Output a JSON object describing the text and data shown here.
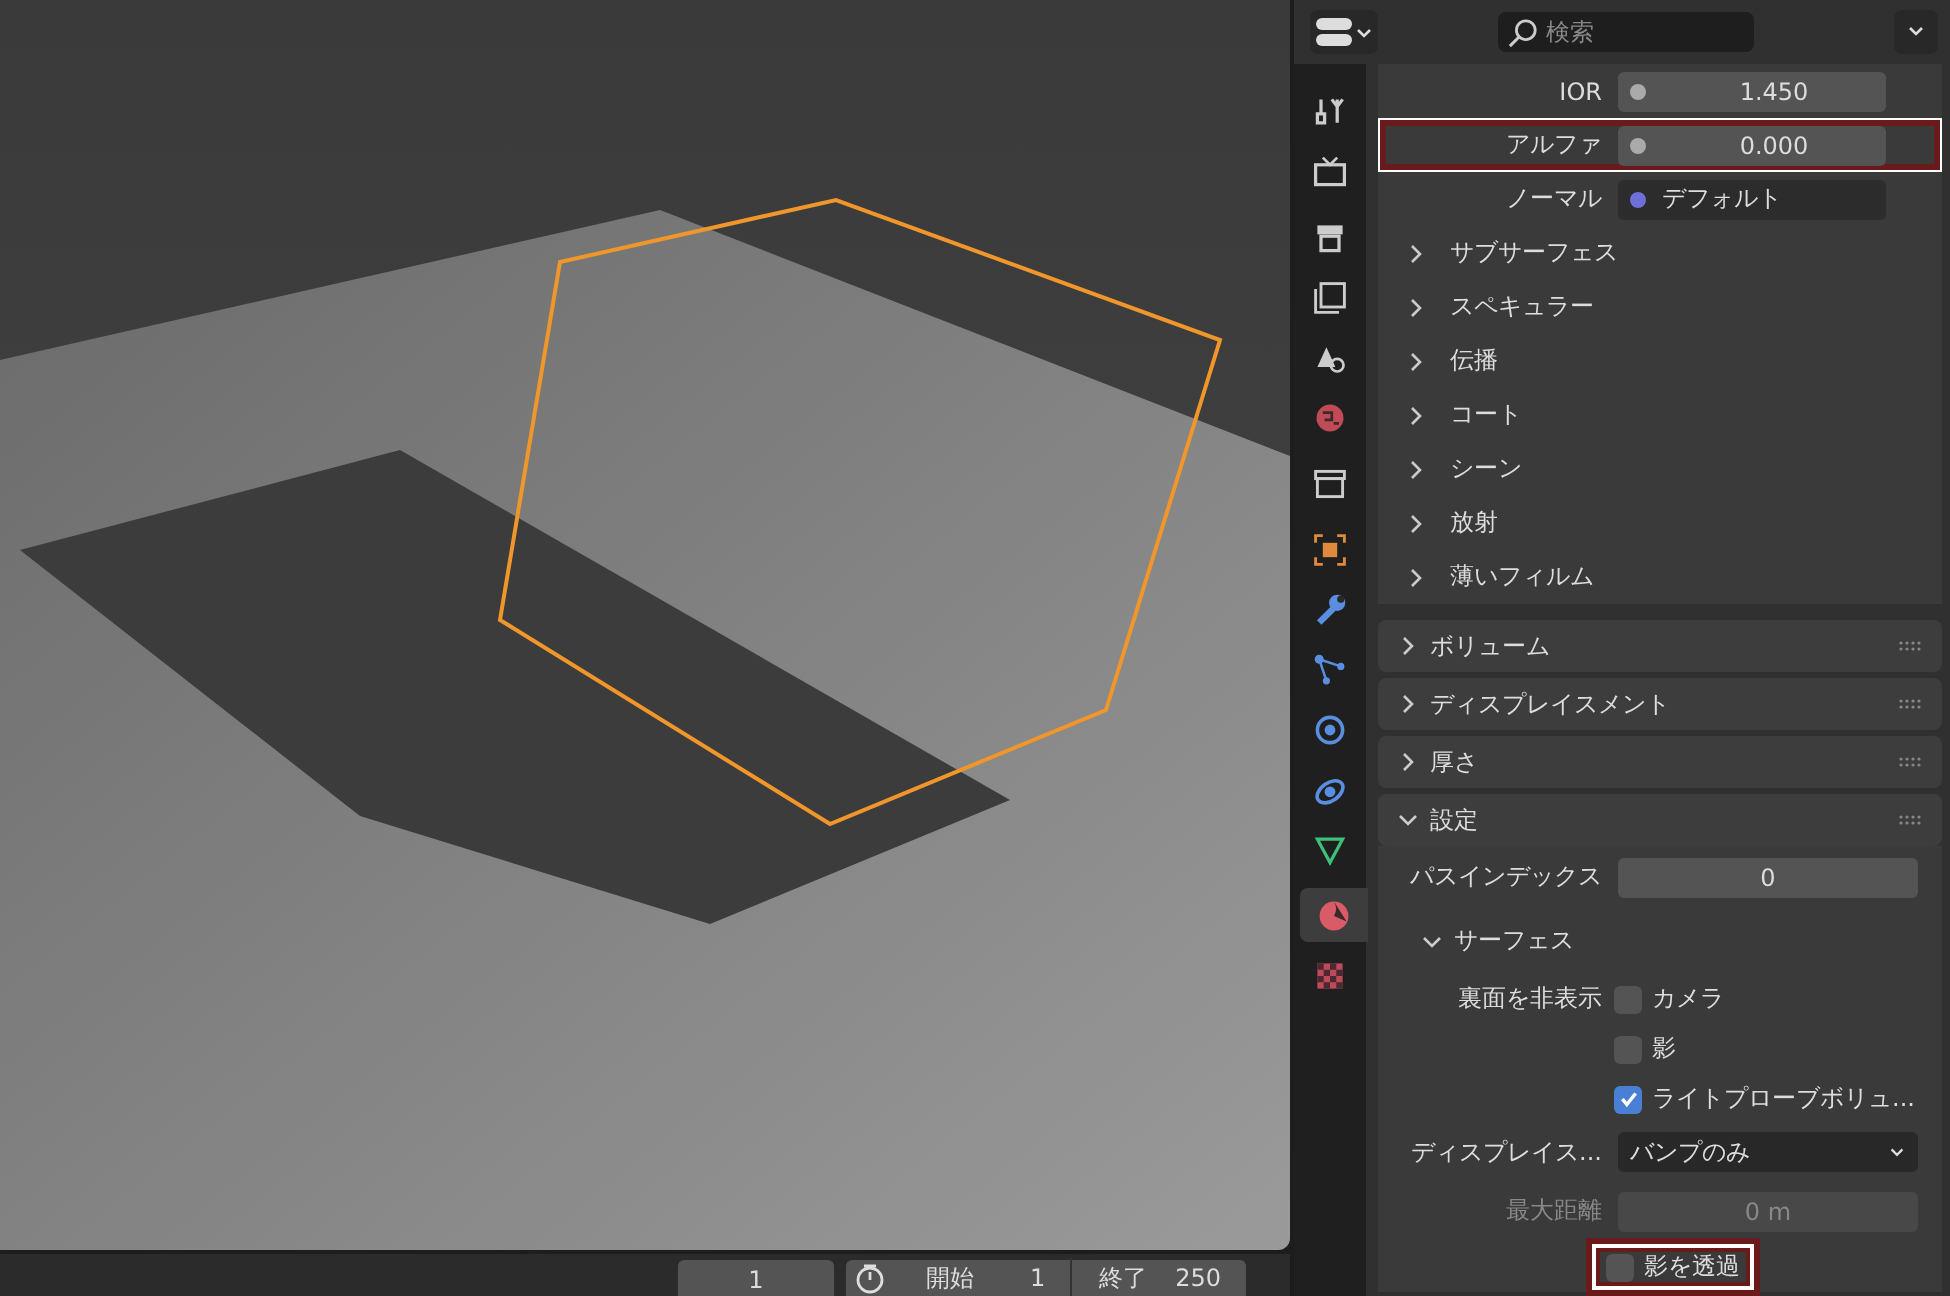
{
  "header": {
    "search_placeholder": "検索"
  },
  "tabs": [
    {
      "kind": "tool",
      "selected": false
    },
    {
      "kind": "render",
      "selected": false
    },
    {
      "kind": "output",
      "selected": false
    },
    {
      "kind": "view",
      "selected": false
    },
    {
      "kind": "scene",
      "selected": false
    },
    {
      "kind": "world",
      "selected": false
    },
    {
      "kind": "collection",
      "selected": false
    },
    {
      "kind": "object",
      "selected": false
    },
    {
      "kind": "modifier",
      "selected": false
    },
    {
      "kind": "particles",
      "selected": false
    },
    {
      "kind": "physics",
      "selected": false
    },
    {
      "kind": "constraints",
      "selected": false
    },
    {
      "kind": "data",
      "selected": false
    },
    {
      "kind": "material",
      "selected": true
    },
    {
      "kind": "texture",
      "selected": false
    }
  ],
  "rows": [
    {
      "kind": "value",
      "label": "IOR",
      "value": "1.450",
      "highlight": false
    },
    {
      "kind": "value",
      "label": "アルファ",
      "value": "0.000",
      "highlight": true
    },
    {
      "kind": "link",
      "label": "ノーマル",
      "value": "デフォルト"
    },
    {
      "kind": "subpanel",
      "label": "サブサーフェス",
      "expanded": false
    },
    {
      "kind": "subpanel",
      "label": "スペキュラー",
      "expanded": false
    },
    {
      "kind": "subpanel",
      "label": "伝播",
      "expanded": false
    },
    {
      "kind": "subpanel",
      "label": "コート",
      "expanded": false
    },
    {
      "kind": "subpanel",
      "label": "シーン",
      "expanded": false
    },
    {
      "kind": "subpanel",
      "label": "放射",
      "expanded": false
    },
    {
      "kind": "subpanel",
      "label": "薄いフィルム",
      "expanded": false
    },
    {
      "kind": "panel",
      "label": "ボリューム",
      "expanded": false
    },
    {
      "kind": "panel",
      "label": "ディスプレイスメント",
      "expanded": false
    },
    {
      "kind": "panel",
      "label": "厚さ",
      "expanded": false
    },
    {
      "kind": "panel",
      "label": "設定",
      "expanded": true
    },
    {
      "kind": "number",
      "label": "パスインデックス",
      "value": "0",
      "disabled": false
    },
    {
      "kind": "subheader",
      "label": "サーフェス",
      "expanded": true
    },
    {
      "kind": "checkbox",
      "label": "裏面を非表示",
      "text": "カメラ",
      "checked": false,
      "highlight": false
    },
    {
      "kind": "checkbox",
      "text": "影",
      "checked": false,
      "highlight": false
    },
    {
      "kind": "checkbox",
      "text": "ライトプローブボリュ...",
      "checked": true,
      "highlight": false
    },
    {
      "kind": "dropdown",
      "label": "ディスプレイス...",
      "value": "バンプのみ"
    },
    {
      "kind": "number",
      "label": "最大距離",
      "value": "0 m",
      "disabled": true
    },
    {
      "kind": "checkbox",
      "text": "影を透過",
      "checked": false,
      "highlight": true
    }
  ],
  "timeline": {
    "current": "1",
    "start_label": "開始",
    "start": "1",
    "end_label": "終了",
    "end": "250"
  }
}
